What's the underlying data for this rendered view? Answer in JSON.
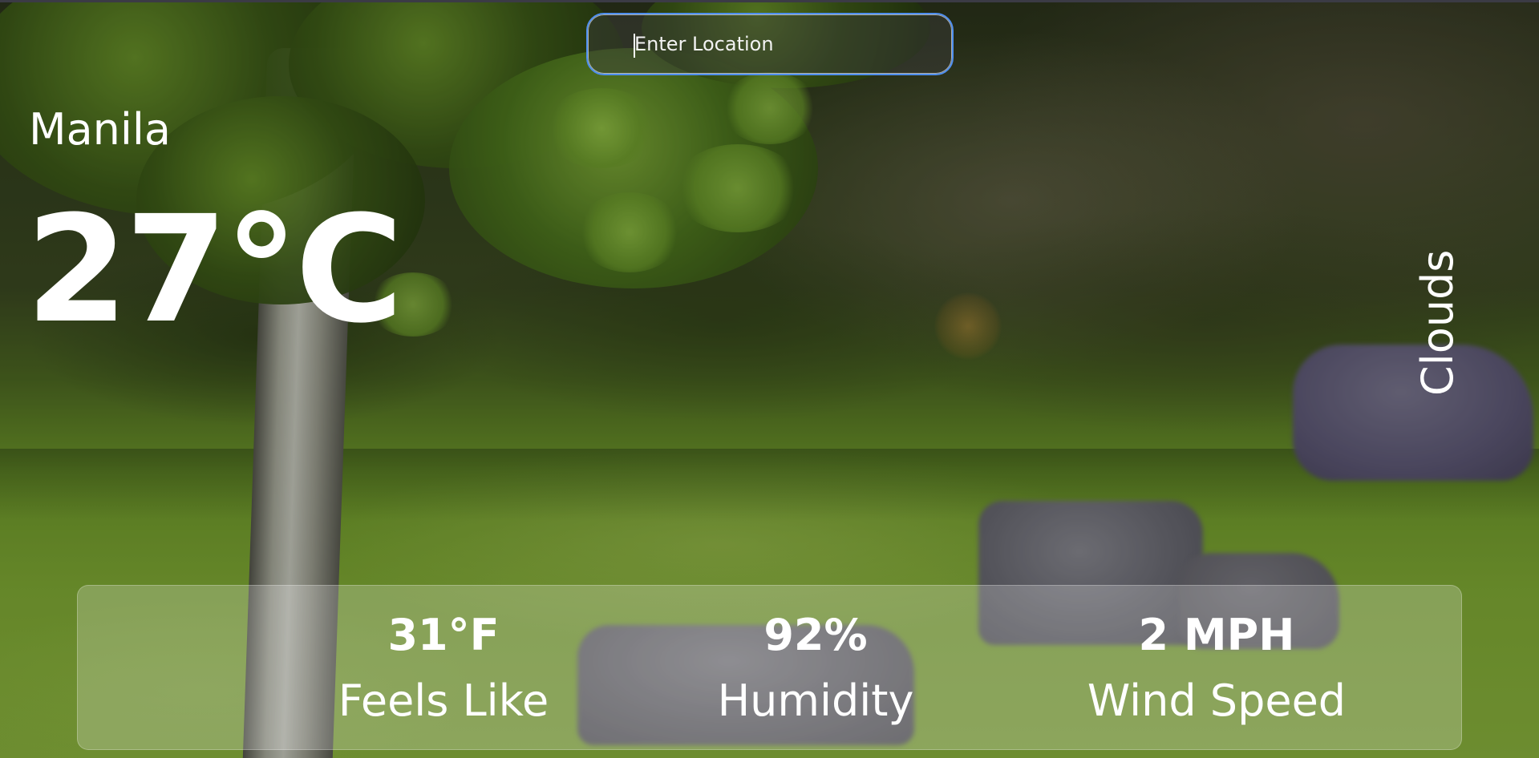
{
  "search": {
    "placeholder": "Enter Location",
    "value": ""
  },
  "weather": {
    "location": "Manila",
    "temperature": "27°C",
    "condition": "Clouds"
  },
  "stats": {
    "feels_like": {
      "value": "31°F",
      "label": "Feels Like"
    },
    "humidity": {
      "value": "92%",
      "label": "Humidity"
    },
    "wind_speed": {
      "value": "2 MPH",
      "label": "Wind Speed"
    }
  },
  "colors": {
    "text": "#ffffff",
    "search_border": "#4f8ff0",
    "panel_background": "rgba(255,255,255,0.22)"
  },
  "background": {
    "subject": "park-with-tree-and-stones-photo"
  }
}
